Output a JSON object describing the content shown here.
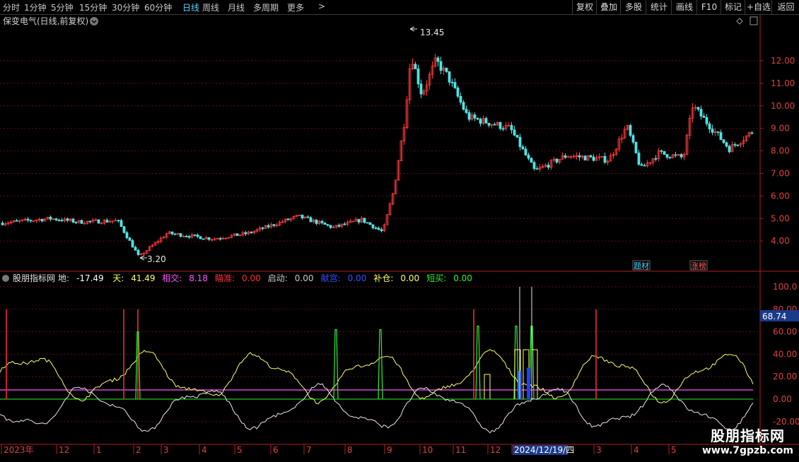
{
  "toolbar": {
    "periods": [
      "分时",
      "1分钟",
      "5分钟",
      "15分钟",
      "30分钟",
      "60分钟",
      "日线",
      "周线",
      "月线",
      "多周期",
      "更多"
    ],
    "active_period": "日线",
    "more_glyph": ">",
    "buttons": [
      "复权",
      "叠加",
      "多股",
      "统计",
      "画线",
      "F10",
      "标记",
      "+自选",
      "返回"
    ]
  },
  "price_panel": {
    "title": "保变电气(日线,前复权)",
    "high_label": "13.45",
    "low_label": "3.20",
    "y_ticks": [
      "12.00",
      "11.00",
      "10.00",
      "9.00",
      "8.00",
      "7.00",
      "6.00",
      "5.00",
      "4.00"
    ],
    "badges": [
      {
        "text": "题材",
        "color": "#5ad0ff"
      },
      {
        "text": "涨榜",
        "color": "#ff6060"
      }
    ]
  },
  "indicator_panel": {
    "name": "股朋指标网",
    "values": [
      {
        "label": "地:",
        "value": "-17.49",
        "color": "#ffffff"
      },
      {
        "label": "天:",
        "value": "41.49",
        "color": "#ffff66"
      },
      {
        "label": "相交:",
        "value": "8.18",
        "color": "#ff55ff"
      },
      {
        "label": "瞄准:",
        "value": "0.00",
        "color": "#ff3030"
      },
      {
        "label": "启动:",
        "value": "0.00",
        "color": "#c8c8c8"
      },
      {
        "label": "献宫:",
        "value": "0.00",
        "color": "#3050ff"
      },
      {
        "label": "补仓:",
        "value": "0.00",
        "color": "#ffff66"
      },
      {
        "label": "短买:",
        "value": "0.00",
        "color": "#33ee33"
      }
    ],
    "y_ticks": [
      "100.0",
      "80.00",
      "60.00",
      "40.00",
      "20.00",
      "0.00",
      "-20.00"
    ],
    "current_value": "68.74"
  },
  "time_axis": {
    "labels": [
      "2023年",
      "12",
      "1",
      "2",
      "3",
      "4",
      "5",
      "6",
      "7",
      "8",
      "9",
      "10",
      "11",
      "12",
      "2024/12/19/四",
      "3",
      "4",
      "5"
    ],
    "selected": "2024/12/19/四"
  },
  "watermark": {
    "title": "股朋指标网",
    "url": "www.7gpzb.com"
  },
  "chart_data": {
    "type": "candlestick",
    "series": [
      {
        "name": "地",
        "y": [
          -17.49
        ]
      },
      {
        "name": "天",
        "y": [
          41.49
        ]
      },
      {
        "name": "相交",
        "y": [
          8.18
        ]
      }
    ],
    "price_range": [
      3.2,
      13.45
    ],
    "indicator_ylim": [
      -20,
      100
    ],
    "grid": true
  }
}
